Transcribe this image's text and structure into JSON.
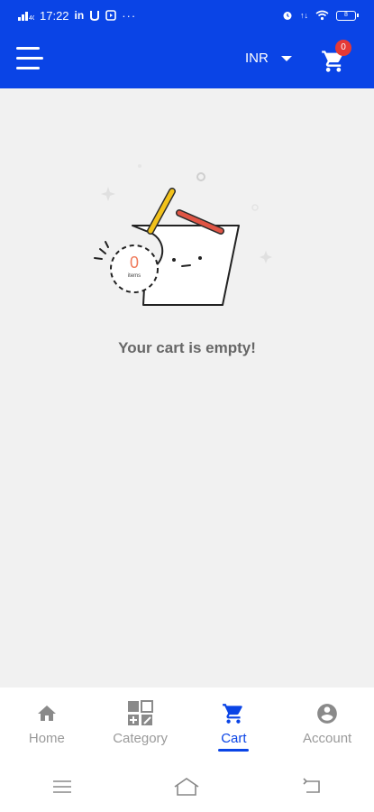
{
  "status_bar": {
    "time": "17:22",
    "battery": "8"
  },
  "app_bar": {
    "currency": "INR",
    "cart_count": "0"
  },
  "empty_state": {
    "badge_count": "0",
    "badge_caption": "items",
    "message": "Your cart is empty!"
  },
  "bottom_nav": {
    "items": [
      {
        "label": "Home",
        "icon": "home-icon"
      },
      {
        "label": "Category",
        "icon": "category-icon"
      },
      {
        "label": "Cart",
        "icon": "cart-icon"
      },
      {
        "label": "Account",
        "icon": "account-icon"
      }
    ],
    "active": "Cart"
  },
  "colors": {
    "brand": "#0a44e6",
    "badge": "#e53935",
    "inactive": "#9a9a9a",
    "background": "#f1f1f1"
  }
}
